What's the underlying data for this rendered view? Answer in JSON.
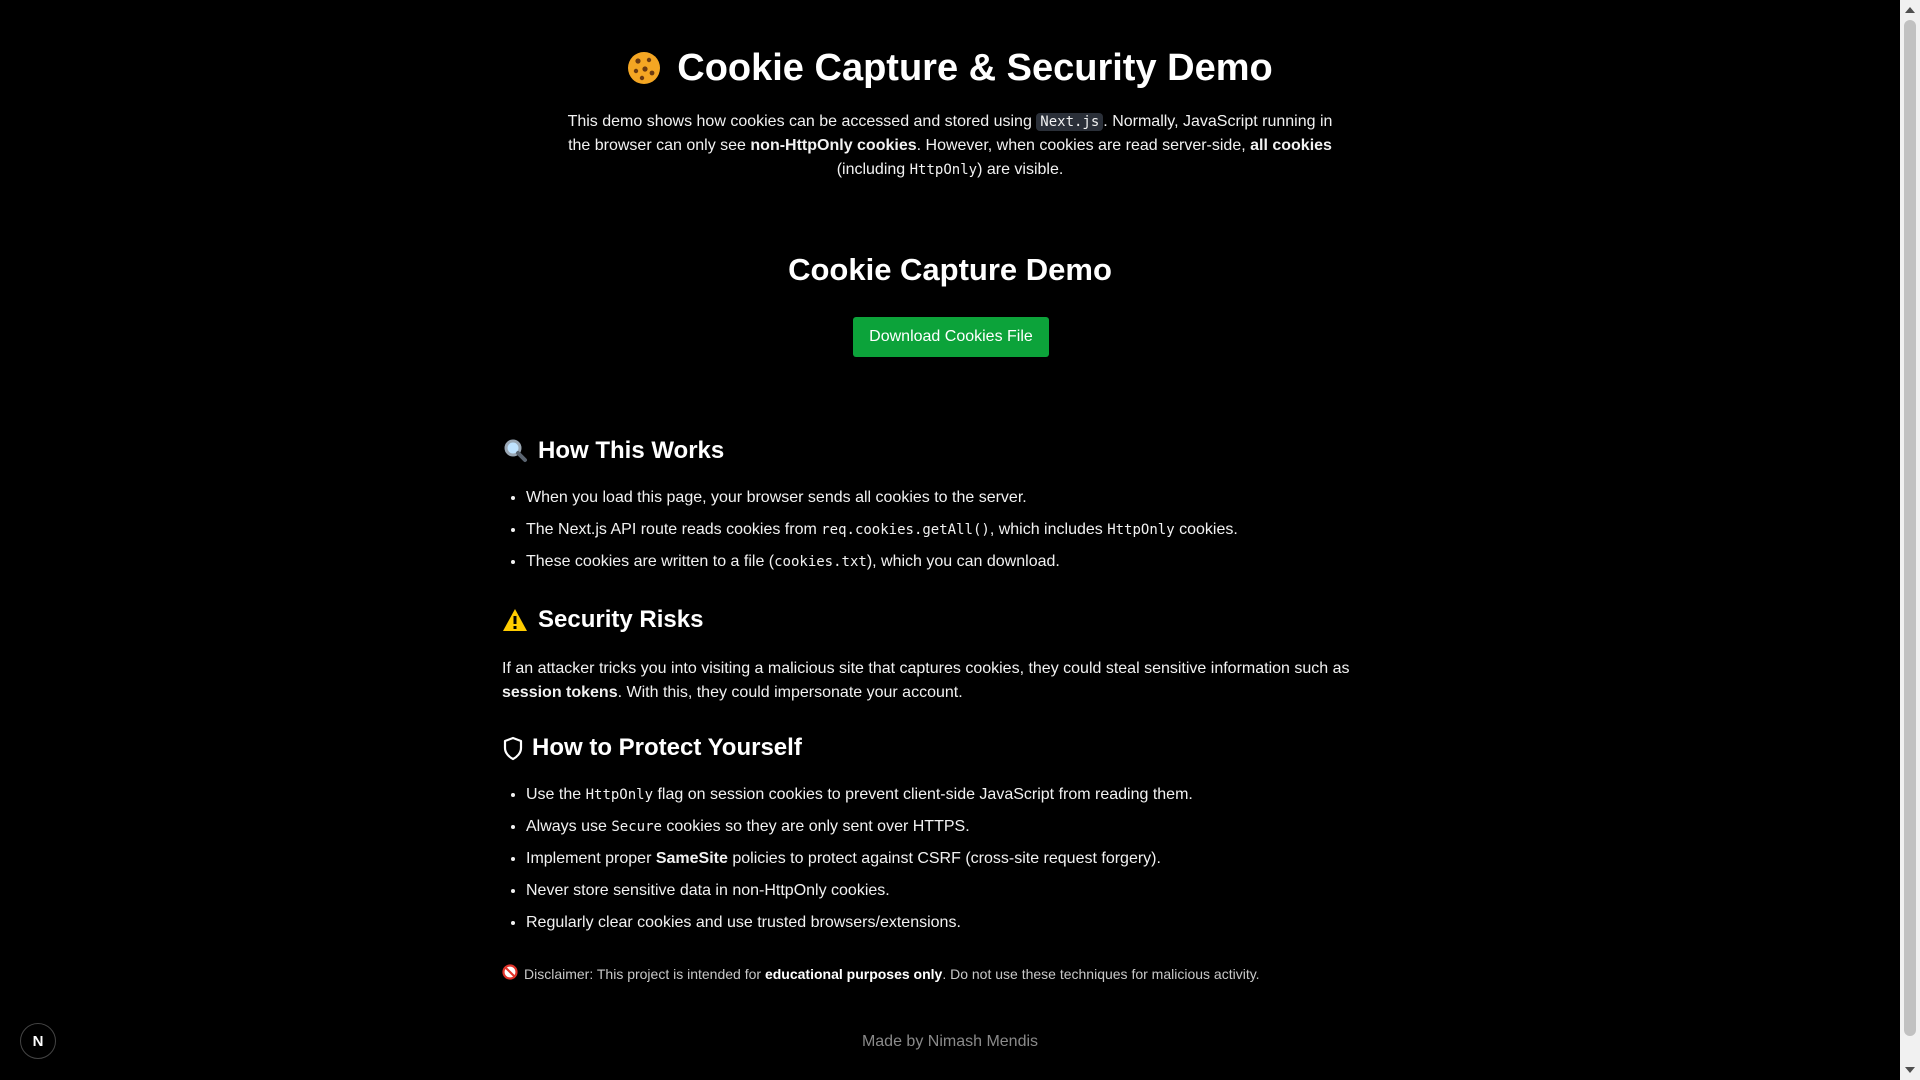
{
  "header": {
    "title": "Cookie Capture & Security Demo",
    "intro": {
      "p1": "This demo shows how cookies can be accessed and stored using ",
      "code1": "Next.js",
      "p2": ". Normally, JavaScript running in the browser can only see ",
      "bold1": "non-HttpOnly cookies",
      "p3": ". However, when cookies are read server-side, ",
      "bold2": "all cookies",
      "p4": " (including ",
      "code2": "HttpOnly",
      "p5": ") are visible."
    }
  },
  "demo": {
    "title": "Cookie Capture Demo",
    "download_label": "Download Cookies File"
  },
  "how_it_works": {
    "heading": "How This Works",
    "item1": "When you load this page, your browser sends all cookies to the server.",
    "item2": {
      "a": "The Next.js API route reads cookies from ",
      "code1": "req.cookies.getAll()",
      "b": ", which includes ",
      "code2": "HttpOnly",
      "c": " cookies."
    },
    "item3": {
      "a": "These cookies are written to a file (",
      "code": "cookies.txt",
      "b": "), which you can download."
    }
  },
  "security_risks": {
    "heading": "Security Risks",
    "p1": "If an attacker tricks you into visiting a malicious site that captures cookies, they could steal sensitive information such as ",
    "bold": "session tokens",
    "p2": ". With this, they could impersonate your account."
  },
  "protect": {
    "heading": "How to Protect Yourself",
    "item1": {
      "a": "Use the ",
      "code": "HttpOnly",
      "b": " flag on session cookies to prevent client-side JavaScript from reading them."
    },
    "item2": {
      "a": "Always use ",
      "code": "Secure",
      "b": " cookies so they are only sent over HTTPS."
    },
    "item3": {
      "a": "Implement proper ",
      "bold": "SameSite",
      "b": " policies to protect against CSRF (cross-site request forgery)."
    },
    "item4": "Never store sensitive data in non-HttpOnly cookies.",
    "item5": "Regularly clear cookies and use trusted browsers/extensions."
  },
  "disclaimer": {
    "a": "Disclaimer: This project is intended for ",
    "bold": "educational purposes only",
    "b": ". Do not use these techniques for malicious activity."
  },
  "footer": {
    "text": "Made by Nimash Mendis"
  },
  "badge": {
    "letter": "N"
  },
  "icons": {
    "title": "cookie-icon",
    "how_it_works": "magnifier-icon",
    "security_risks": "warning-icon",
    "protect": "shield-icon",
    "disclaimer": "prohibited-icon"
  },
  "colors": {
    "background": "#000000",
    "button": "#0ca33a",
    "cookie": "#f4a623",
    "warning": "#ffcc00",
    "footer_text": "#8a8a8a"
  }
}
